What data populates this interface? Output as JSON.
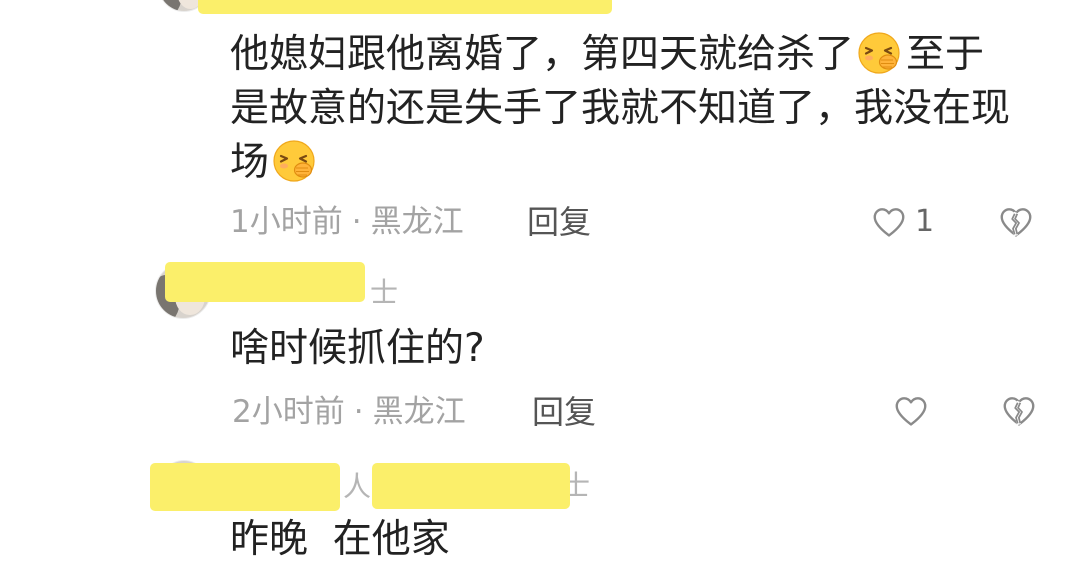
{
  "colors": {
    "text": "#222222",
    "meta": "#a3a3a3",
    "reply": "#555555",
    "icon": "#8a8a8a",
    "count": "#666666",
    "redaction": "#fbef6a",
    "uname": "#b5b5b5"
  },
  "icons": {
    "emoji": "shushing-face",
    "like": "heart-outline",
    "dislike": "broken-heart-outline"
  },
  "thread": {
    "comments": [
      {
        "segments": [
          "他媳妇跟他离婚了，第四天就给杀了",
          "至于是故意的还是失手了我就不知道了，我没在现场"
        ],
        "time": "1小时前",
        "separator": "·",
        "location": "黑龙江",
        "reply_label": "回复",
        "like_count": "1"
      },
      {
        "username_fragments": [
          "士"
        ],
        "text": "啥时候抓住的?",
        "time": "2小时前",
        "separator": "·",
        "location": "黑龙江",
        "reply_label": "回复"
      },
      {
        "username_fragments": [
          "人",
          "士"
        ],
        "text": "昨晚  在他家"
      }
    ]
  }
}
